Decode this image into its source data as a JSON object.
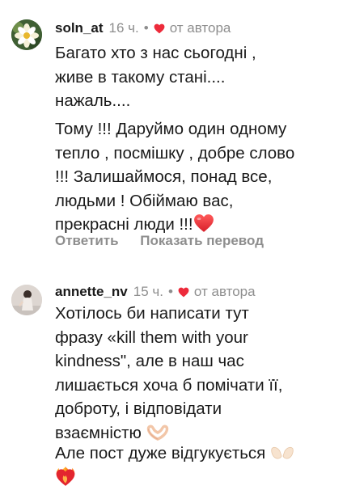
{
  "comments": [
    {
      "username": "soln_at",
      "time": "16 ч.",
      "separator": "•",
      "author_label": "от автора",
      "paragraphs": [
        [
          "Багато хто з нас сьогодні ,",
          "живе в такому стані....",
          "нажаль...."
        ],
        [
          "Тому !!! Даруймо один одному",
          "тепло , посмішку , добре слово",
          "!!! Залишаймося, понад все,",
          "людьми ! Обіймаю вас,",
          "прекрасні люди !!!"
        ]
      ],
      "reply_label": "Ответить",
      "translate_label": "Показать перевод",
      "avatar": "flower-avatar",
      "emoji": "red-heart-icon"
    },
    {
      "username": "annette_nv",
      "time": "15 ч.",
      "separator": "•",
      "author_label": "от автора",
      "paragraphs": [
        [
          "Хотілось би написати тут",
          "фразу «kill them with your",
          "kindness\", але в наш час",
          "лишається хоча б помічати її,",
          "доброту, і відповідати",
          "взаємністю"
        ],
        [
          "Але пост дуже відгукується",
          ""
        ]
      ],
      "avatar": "person-avatar",
      "emojis": [
        "heart-hands-icon",
        "open-hands-icon",
        "burning-heart-icon"
      ]
    }
  ],
  "colors": {
    "text": "#1a1a1a",
    "meta": "#8e8e8e",
    "heart": "#ed2b3b",
    "background": "#ffffff"
  }
}
